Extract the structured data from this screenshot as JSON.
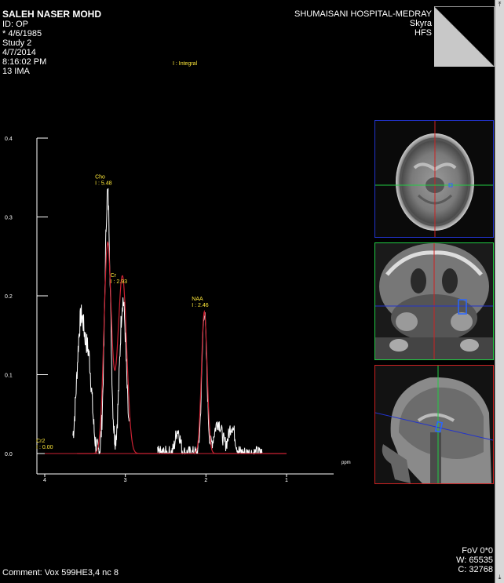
{
  "patient": {
    "name": "SALEH NASER MOHD",
    "id": "ID: OP",
    "dob": "* 4/6/1985",
    "study": "Study 2",
    "date": "4/7/2014",
    "time": "8:16:02 PM",
    "ima": "13 IMA"
  },
  "institution": {
    "name": "SHUMAISANI HOSPITAL-MEDRAY",
    "model": "Skyra",
    "position": "HFS"
  },
  "legend": "I : Integral",
  "bottom": {
    "comment": "Comment: Vox 599HE3,4  nc  8",
    "fov": "FoV 0*0",
    "window": "W: 65535",
    "center": "C: 32768"
  },
  "chart_data": {
    "type": "line",
    "xlabel": "ppm",
    "ylabel": "",
    "xlim": [
      4,
      1
    ],
    "ylim": [
      0,
      0.4
    ],
    "x_ticks": [
      "4",
      "3",
      "2",
      "1"
    ],
    "y_ticks": [
      "0.4",
      "0.3",
      "0.2",
      "0.1",
      "0.0"
    ],
    "peaks": [
      {
        "name": "Cho",
        "integral": "I : 5.48",
        "ppm": 3.22,
        "height": 0.335
      },
      {
        "name": "Cr",
        "integral": "I : 2.93",
        "ppm": 3.03,
        "height": 0.21
      },
      {
        "name": "NAA",
        "integral": "I : 2.46",
        "ppm": 2.02,
        "height": 0.18
      },
      {
        "name": "Cr2",
        "integral": "I : 0.00",
        "ppm": 3.95,
        "height": 0.0
      }
    ],
    "series": [
      {
        "name": "spectrum",
        "color": "#ffffff"
      },
      {
        "name": "fit",
        "color": "#cc2233"
      }
    ]
  },
  "colors": {
    "axial_border": "#2233cc",
    "coronal_border": "#22cc44",
    "sagittal_border": "#cc2222",
    "accent_text": "#ffe93a"
  }
}
